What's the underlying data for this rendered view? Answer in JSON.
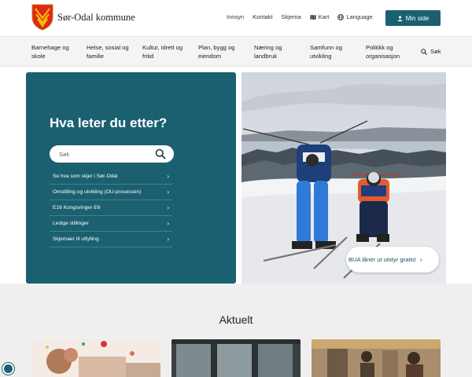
{
  "brand": {
    "name": "Sør-Odal kommune",
    "logo": "coat-of-arms-logo"
  },
  "top_links": [
    {
      "label": "Innsyn"
    },
    {
      "label": "Kontakt"
    },
    {
      "label": "Skjema"
    },
    {
      "label": "Kart",
      "icon": "map-icon"
    },
    {
      "label": "Language",
      "icon": "globe-icon"
    }
  ],
  "my_page_button": {
    "label": "Min side",
    "icon": "user-icon"
  },
  "nav": {
    "items": [
      {
        "label": "Barnehage og skole"
      },
      {
        "label": "Helse, sosial og familie"
      },
      {
        "label": "Kultur, idrett og fritid"
      },
      {
        "label": "Plan, bygg og eiendom"
      },
      {
        "label": "Næring og landbruk"
      },
      {
        "label": "Samfunn og utvikling"
      },
      {
        "label": "Politikk og organisasjon"
      }
    ],
    "search_label": "Søk"
  },
  "hero": {
    "title": "Hva leter du etter?",
    "search_placeholder": "Søk",
    "quick_links": [
      {
        "label": "Se hva som skjer i Sør-Odal"
      },
      {
        "label": "Omstilling og utvikling (OU-prosessen)"
      },
      {
        "label": "E16 Kongsvinger-E6"
      },
      {
        "label": "Ledige stillinger"
      },
      {
        "label": "Skjemaer til utfylling"
      }
    ],
    "feature_link": {
      "label": "BUA låner ut utstyr gratis!"
    }
  },
  "news": {
    "title": "Aktuelt"
  },
  "colors": {
    "primary": "#1b6070",
    "nav_bg": "#f4f4f4",
    "news_bg": "#efefef"
  }
}
